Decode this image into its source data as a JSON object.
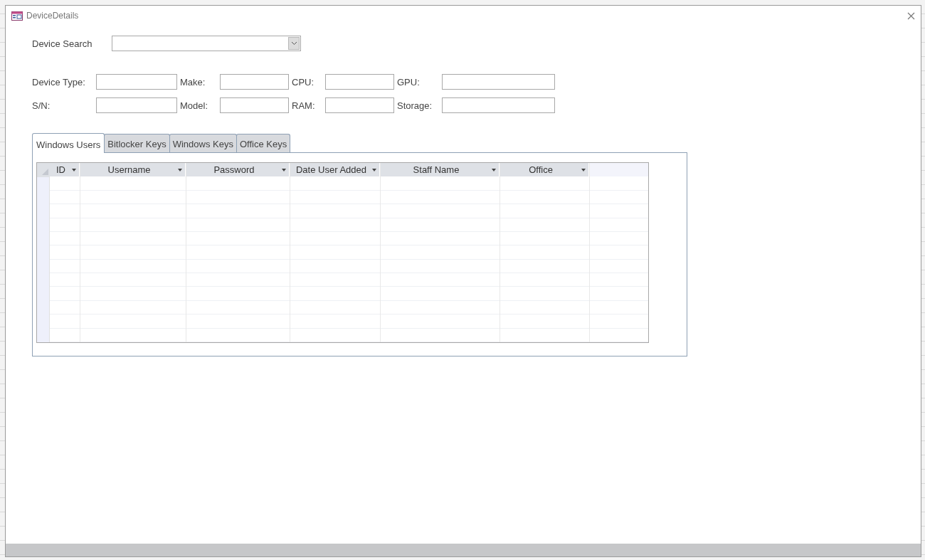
{
  "window": {
    "title": "DeviceDetails"
  },
  "device_search": {
    "label": "Device Search"
  },
  "fields": [
    {
      "label": "Device Type:"
    },
    {
      "label": "Make:"
    },
    {
      "label": "CPU:"
    },
    {
      "label": "GPU:"
    },
    {
      "label": "S/N:"
    },
    {
      "label": "Model:"
    },
    {
      "label": "RAM:"
    },
    {
      "label": "Storage:"
    }
  ],
  "tabs": [
    {
      "label": "Windows Users",
      "selected": true
    },
    {
      "label": "Bitlocker Keys",
      "selected": false
    },
    {
      "label": "Windows Keys",
      "selected": false
    },
    {
      "label": "Office Keys",
      "selected": false
    }
  ],
  "table": {
    "columns": [
      {
        "name": "ID"
      },
      {
        "name": "Username"
      },
      {
        "name": "Password"
      },
      {
        "name": "Date User Added"
      },
      {
        "name": "Staff Name"
      },
      {
        "name": "Office"
      }
    ]
  }
}
